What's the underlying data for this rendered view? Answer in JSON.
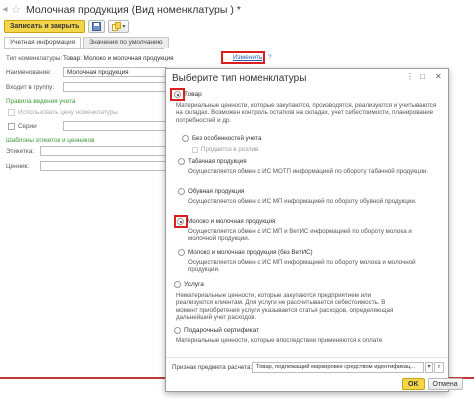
{
  "window": {
    "title": "Молочная продукция (Вид номенклатуры ) *",
    "star_icon": "star-icon",
    "menu_icon": "more-icon"
  },
  "toolbar": {
    "save_close_label": "Записать и закрыть",
    "save_icon": "save-icon",
    "copy_icon": "copy-icon"
  },
  "tabs": [
    {
      "label": "Учетная информация"
    },
    {
      "label": "Значения по умолчанию"
    }
  ],
  "form": {
    "type_label": "Тип номенклатуры:",
    "type_value": "Товар: Молоко и молочная продукция",
    "change_link": "Изменить",
    "help": "?",
    "name_label": "Наименование:",
    "name_value": "Молочная продукция",
    "group_label": "Входит в группу:",
    "rules_header": "Правила ведения учета",
    "use_price_label": "Использовать цену номенклатуры",
    "series_label": "Серии",
    "templates_header": "Шаблоны этикеток и ценников",
    "label_label": "Этикетка:",
    "price_tag_label": "Ценник:"
  },
  "dialog": {
    "title": "Выберите тип номенклатуры",
    "controls": [
      "⋮",
      "□",
      "✕"
    ],
    "options": [
      {
        "label": "Товар",
        "selected": true,
        "desc": "Материальные ценности, которые закупаются, производятся, реализуются и учитываются на складах. Возможен контроль остатков на складах, учет себестоимости, планирование потребностей и др."
      },
      {
        "label": "Без особенностей учета",
        "selected": false,
        "sub": true
      },
      {
        "label": "Продается в розлив",
        "selected": false,
        "sub": true,
        "dim": true
      },
      {
        "label": "Табачная продукция",
        "selected": false,
        "sub": true,
        "desc": "Осуществляется обмен с ИС МОТП информацией по обороту табачной продукции."
      },
      {
        "label": "Обувная продукция",
        "selected": false,
        "sub": true,
        "desc": "Осуществляется обмен с ИС МП информацией по обороту обувной продукции."
      },
      {
        "label": "Молоко и молочная продукция",
        "selected": true,
        "sub": true,
        "desc": "Осуществляется обмен с ИС МП и ВетИС информацией по обороту молока и молочной продукции."
      },
      {
        "label": "Молоко и молочная продукция (без ВетИС)",
        "selected": false,
        "sub": true,
        "desc": "Осуществляется обмен с ИС МП информацией по обороту молока и молочной продукции."
      },
      {
        "label": "Услуга",
        "selected": false,
        "desc": "Нематериальные ценности, которые закупаются предприятием или реализуются клиентам. Для услуги не рассчитывается себестоимость. В момент приобретения услуги указывается статья расходов, определяющая дальнейший учет расходов."
      },
      {
        "label": "Подарочный сертификат",
        "selected": false,
        "desc": "Материальные ценности, которые впоследствии применяются к оплате"
      }
    ],
    "sign_label": "Признак предмета расчета:",
    "sign_value": "Товар, подлежащий маркировке средством идентификац...",
    "ok_label": "OK",
    "cancel_label": "Отмена"
  },
  "colors": {
    "accent": "#f5d54a",
    "highlight": "#d9201f",
    "link": "#2a5db0",
    "section": "#3a9a3a"
  }
}
